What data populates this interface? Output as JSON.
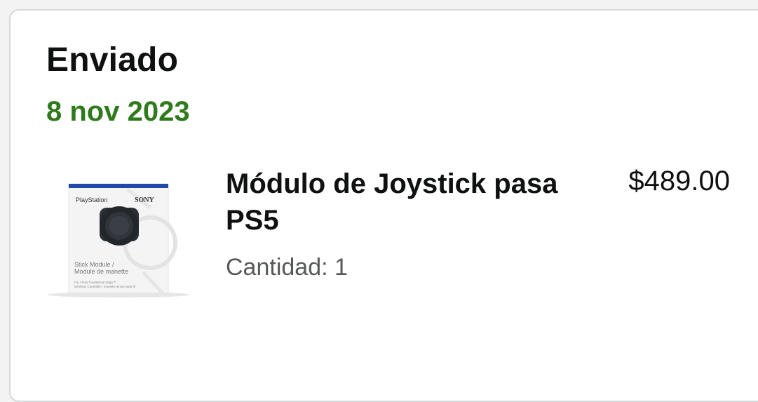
{
  "shipment": {
    "status": "Enviado",
    "date": "8 nov 2023",
    "date_color": "#2f7a1c"
  },
  "item": {
    "title": "Módulo de Joystick pasa PS5",
    "quantity_text": "Cantidad: 1",
    "price": "$489.00",
    "image": {
      "icon": "product-box-image",
      "brand_left": "PlayStation",
      "brand_right": "SONY",
      "line1": "Stick Module /",
      "line2": "Module de manette",
      "fine1": "For / Pour DualSense Edge™",
      "fine2": "Wireless Controller / manette de jeu sans fil"
    }
  }
}
